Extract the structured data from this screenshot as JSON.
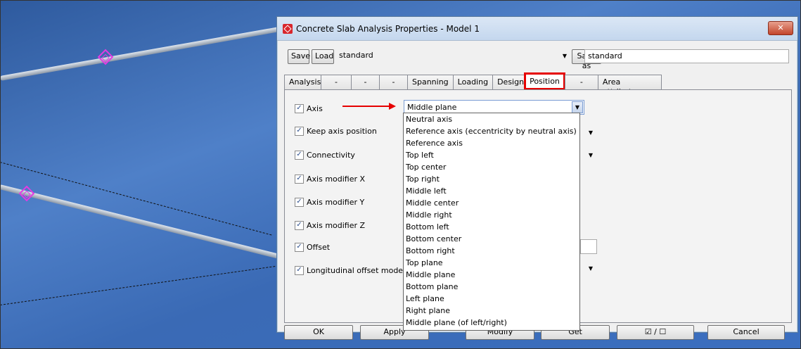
{
  "dialog": {
    "title": "Concrete Slab Analysis Properties - Model 1",
    "close_label": "✕"
  },
  "toolbar": {
    "save_label": "Save",
    "load_label": "Load",
    "preset_value": "standard",
    "save_as_label": "Save as",
    "save_as_value": "standard"
  },
  "tabs": [
    {
      "label": "Analysis"
    },
    {
      "label": "-"
    },
    {
      "label": "-"
    },
    {
      "label": "-"
    },
    {
      "label": "Spanning"
    },
    {
      "label": "Loading"
    },
    {
      "label": "Design"
    },
    {
      "label": "Position",
      "active": true
    },
    {
      "label": "-"
    },
    {
      "label": "Area attributes"
    }
  ],
  "rows": [
    {
      "label": "Axis",
      "checked": true
    },
    {
      "label": "Keep axis position",
      "checked": true
    },
    {
      "label": "Connectivity",
      "checked": true
    },
    {
      "label": "Axis modifier X",
      "checked": true
    },
    {
      "label": "Axis modifier Y",
      "checked": true
    },
    {
      "label": "Axis modifier Z",
      "checked": true
    },
    {
      "label": "Offset",
      "checked": true
    },
    {
      "label": "Longitudinal offset mode",
      "checked": true
    }
  ],
  "axis_select": {
    "value": "Middle plane",
    "options": [
      "Neutral axis",
      "Reference axis (eccentricity by neutral axis)",
      "Reference axis",
      "Top left",
      "Top center",
      "Top right",
      "Middle left",
      "Middle center",
      "Middle right",
      "Bottom left",
      "Bottom center",
      "Bottom right",
      "Top plane",
      "Middle plane",
      "Bottom plane",
      "Left plane",
      "Right plane",
      "Middle plane (of left/right)"
    ]
  },
  "bottom_buttons": {
    "ok": "OK",
    "apply": "Apply",
    "modify": "Modify",
    "get": "Get",
    "toggle": "☑ / ☐",
    "cancel": "Cancel"
  },
  "colors": {
    "annotation_red": "#e60000",
    "node_magenta": "#e33be3",
    "viewport_blue": "#3d6bb0"
  }
}
